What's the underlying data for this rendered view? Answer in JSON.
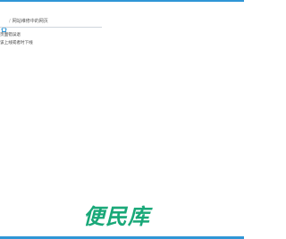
{
  "breadcrumb": {
    "home_icon": "home-icon",
    "separator": "/",
    "current": "网站维修中的网页"
  },
  "messages": [
    "页面错误退",
    "该上线或者时下线"
  ],
  "footer_logo": {
    "text": "便民库"
  },
  "colors": {
    "accent": "#2f96d6",
    "logo": "#19a878"
  }
}
